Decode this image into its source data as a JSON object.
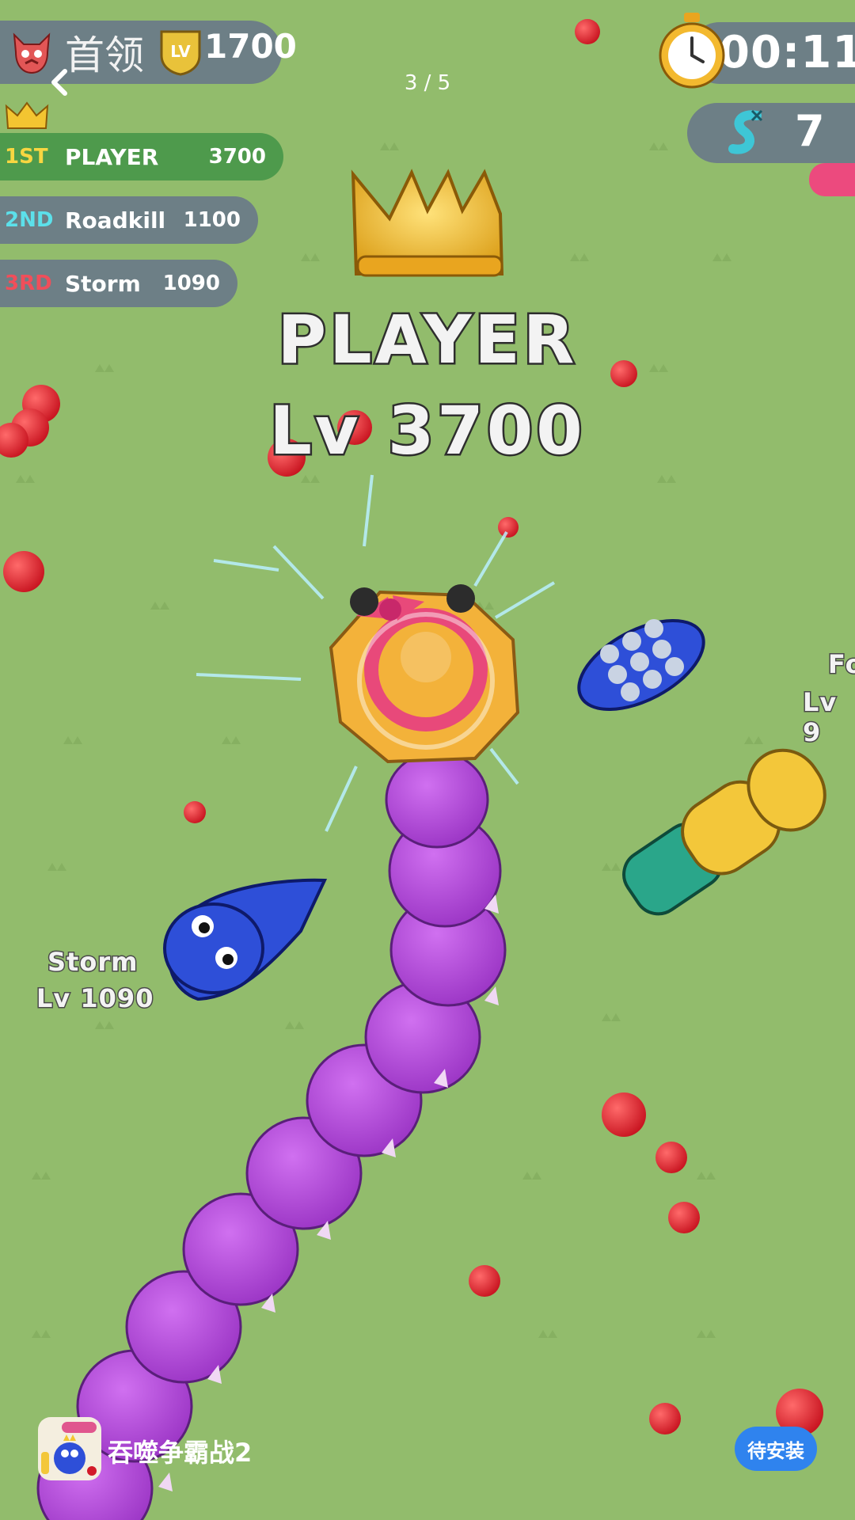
{
  "hud": {
    "boss_label": "首领",
    "boss_level_badge": "LV",
    "boss_score": "1700",
    "timer": "00:11",
    "kills": "7"
  },
  "leaderboard": [
    {
      "pos": "1ST",
      "name": "PLAYER",
      "score": "3700"
    },
    {
      "pos": "2ND",
      "name": "Roadkill",
      "score": "1100"
    },
    {
      "pos": "3RD",
      "name": "Storm",
      "score": "1090"
    }
  ],
  "pager": "3 / 5",
  "player": {
    "name": "PLAYER",
    "level": "Lv 3700"
  },
  "enemies": [
    {
      "name": "Storm",
      "level": "Lv 1090"
    },
    {
      "name": "Fo",
      "level": "Lv 9"
    }
  ],
  "footer": {
    "app_name": "吞噬争霸战2",
    "install_label": "待安装"
  },
  "icons": [
    "back-arrow-icon",
    "devil-icon",
    "level-badge-icon",
    "stopwatch-icon",
    "snake-kill-icon",
    "crown-icon",
    "apple-icon"
  ],
  "colors": {
    "grass": "#92bc6c",
    "hud_pill": "#6d7f86",
    "first_place": "#4e9a4c",
    "snake_body": "#b44ed9",
    "install_button": "#2f83ee"
  }
}
